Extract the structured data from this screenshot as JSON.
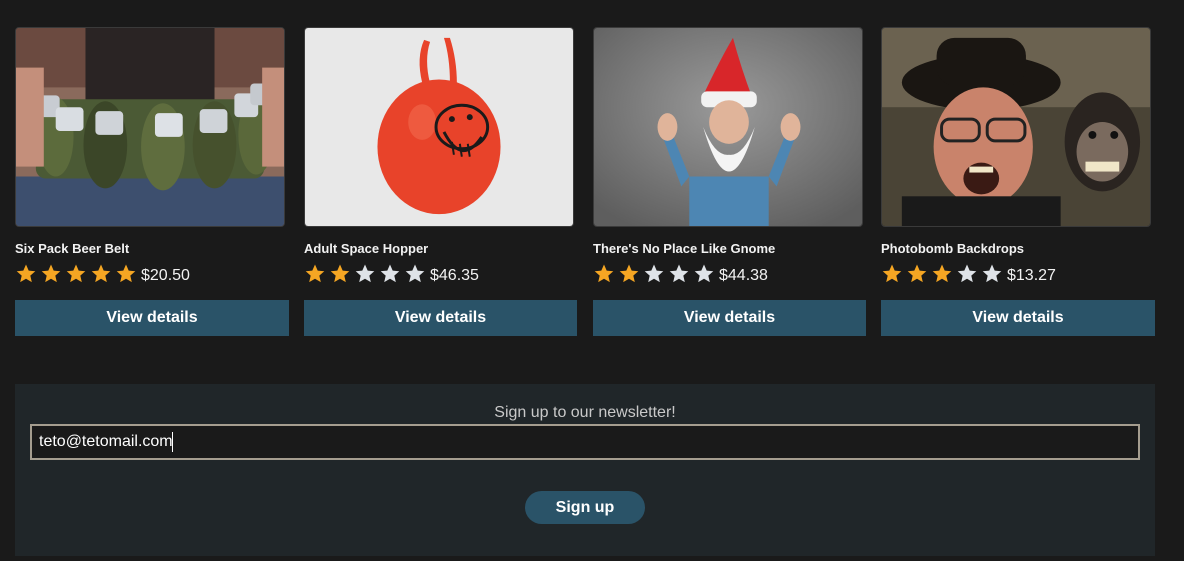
{
  "colors": {
    "background": "#1a1a1a",
    "button": "#2a5368",
    "star_filled": "#f5a623",
    "star_empty": "#dfe3e8",
    "newsletter_bg": "#202629",
    "input_border": "#a59d8f"
  },
  "products": [
    {
      "name": "Six Pack Beer Belt",
      "rating": 5,
      "rating_max": 5,
      "price": "$20.50",
      "button_label": "View details",
      "image": "beer-belt-photo"
    },
    {
      "name": "Adult Space Hopper",
      "rating": 2,
      "rating_max": 5,
      "price": "$46.35",
      "button_label": "View details",
      "image": "space-hopper-photo"
    },
    {
      "name": "There's No Place Like Gnome",
      "rating": 2,
      "rating_max": 5,
      "price": "$44.38",
      "button_label": "View details",
      "image": "gnome-costume-photo"
    },
    {
      "name": "Photobomb Backdrops",
      "rating": 3,
      "rating_max": 5,
      "price": "$13.27",
      "button_label": "View details",
      "image": "photobomb-monkey-photo"
    }
  ],
  "newsletter": {
    "title": "Sign up to our newsletter!",
    "email_value": "teto@tetomail.com",
    "button_label": "Sign up"
  }
}
